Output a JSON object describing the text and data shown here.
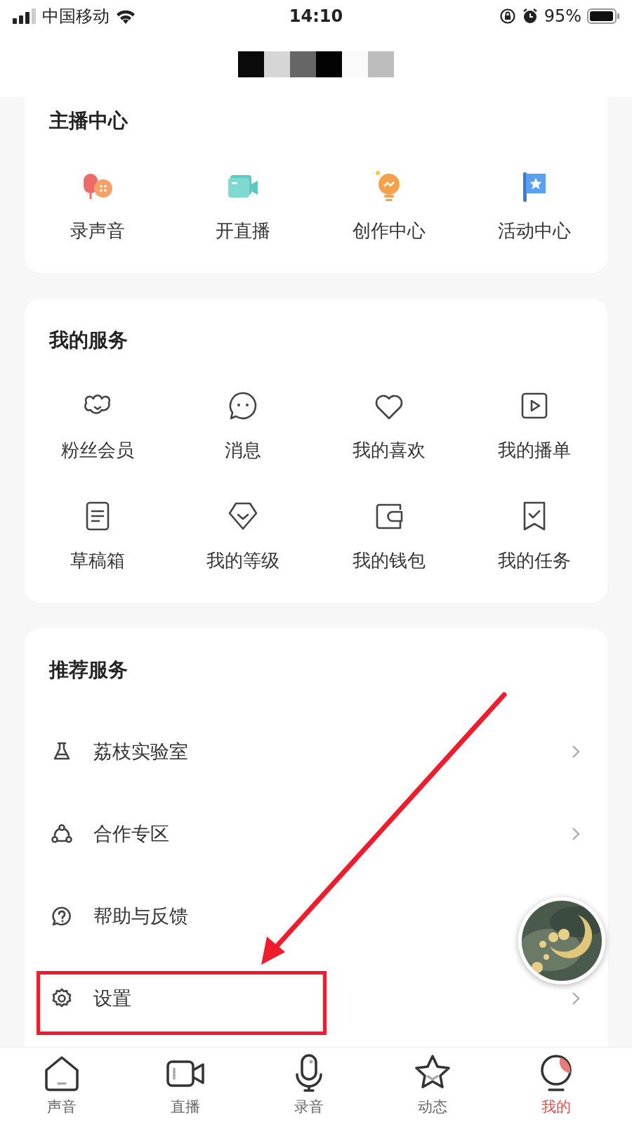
{
  "status_bar": {
    "carrier": "中国移动",
    "time": "14:10",
    "battery": "95%"
  },
  "sections": [
    {
      "kind": "grid",
      "title": "主播中心",
      "items": [
        {
          "label": "录声音"
        },
        {
          "label": "开直播"
        },
        {
          "label": "创作中心"
        },
        {
          "label": "活动中心"
        }
      ]
    },
    {
      "kind": "grid",
      "title": "我的服务",
      "items": [
        {
          "label": "粉丝会员"
        },
        {
          "label": "消息"
        },
        {
          "label": "我的喜欢"
        },
        {
          "label": "我的播单"
        },
        {
          "label": "草稿箱"
        },
        {
          "label": "我的等级"
        },
        {
          "label": "我的钱包"
        },
        {
          "label": "我的任务"
        }
      ]
    },
    {
      "kind": "list",
      "title": "推荐服务",
      "items": [
        {
          "label": "荔枝实验室",
          "chevron": true
        },
        {
          "label": "合作专区",
          "chevron": true
        },
        {
          "label": "帮助与反馈",
          "chevron": false
        },
        {
          "label": "设置",
          "chevron": true
        }
      ]
    }
  ],
  "tabs": [
    {
      "label": "声音",
      "selected": false
    },
    {
      "label": "直播",
      "selected": false
    },
    {
      "label": "录音",
      "selected": false
    },
    {
      "label": "动态",
      "selected": false
    },
    {
      "label": "我的",
      "selected": true
    }
  ]
}
